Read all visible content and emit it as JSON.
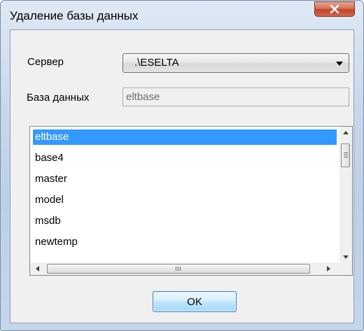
{
  "window": {
    "title": "Удаление базы данных"
  },
  "form": {
    "server_label": "Сервер",
    "server_value": ".\\ESELTA",
    "database_label": "База данных",
    "database_value": "eltbase"
  },
  "list": {
    "items": [
      {
        "label": "eltbase",
        "selected": true
      },
      {
        "label": "base4",
        "selected": false
      },
      {
        "label": "master",
        "selected": false
      },
      {
        "label": "model",
        "selected": false
      },
      {
        "label": "msdb",
        "selected": false
      },
      {
        "label": "newtemp",
        "selected": false
      }
    ]
  },
  "buttons": {
    "ok_label": "OK"
  },
  "colors": {
    "selection": "#3399ff",
    "close_button": "#c1432a"
  },
  "icons": {
    "close": "close-icon"
  }
}
